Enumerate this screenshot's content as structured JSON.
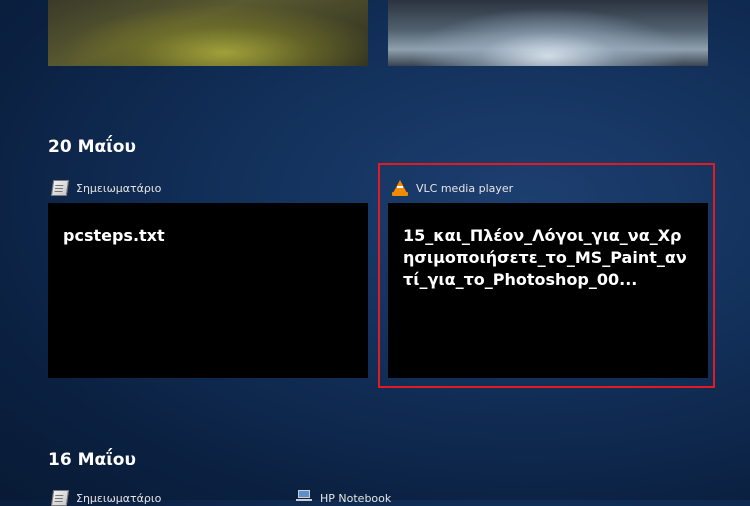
{
  "groups": [
    {
      "date": "20 Μαΐου",
      "activities": [
        {
          "app": "Σημειωματάριο",
          "icon": "notepad-icon",
          "title": "pcsteps.txt"
        },
        {
          "app": "VLC media player",
          "icon": "vlc-icon",
          "title": "15_και_Πλέον_Λόγοι_για_να_Χρησιμοποιήσετε_το_MS_Paint_αντί_για_το_Photoshop_00..."
        }
      ]
    },
    {
      "date": "16 Μαΐου",
      "activities": [
        {
          "app": "Σημειωματάριο",
          "icon": "notepad-icon"
        },
        {
          "app": "HP Notebook",
          "icon": "laptop-icon"
        }
      ]
    }
  ],
  "colors": {
    "highlight": "#e21b23",
    "card_bg": "#000000"
  }
}
